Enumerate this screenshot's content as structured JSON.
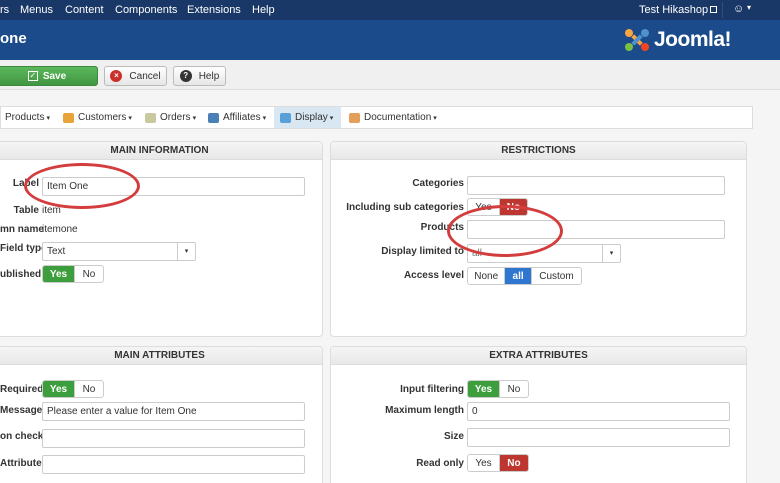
{
  "menubar": {
    "items": [
      "rs",
      "Menus",
      "Content",
      "Components",
      "Extensions",
      "Help"
    ],
    "user": "Test Hikashop",
    "user_icon": "user-icon"
  },
  "header": {
    "title": "one",
    "logo_text": "Joomla!"
  },
  "toolbar": {
    "save_label": "Save",
    "cancel_label": "Cancel",
    "help_label": "Help"
  },
  "nav": {
    "items": [
      {
        "label": "Products",
        "icon": "products-icon"
      },
      {
        "label": "Customers",
        "icon": "customers-icon"
      },
      {
        "label": "Orders",
        "icon": "orders-icon"
      },
      {
        "label": "Affiliates",
        "icon": "affiliates-icon"
      },
      {
        "label": "Display",
        "icon": "display-icon"
      },
      {
        "label": "Documentation",
        "icon": "documentation-icon"
      }
    ],
    "active": "Display"
  },
  "main_information": {
    "title": "MAIN INFORMATION",
    "label_label": "Label",
    "label_value": "Item One",
    "table_label": "Table",
    "table_value": "item",
    "column_label": "mn name",
    "column_value": "itemone",
    "field_type_label": "Field type",
    "field_type_value": "Text",
    "published_label": "ublished",
    "published_yes": "Yes",
    "published_no": "No"
  },
  "restrictions": {
    "title": "RESTRICTIONS",
    "categories_label": "Categories",
    "categories_value": "",
    "subcat_label": "Including sub categories",
    "subcat_yes": "Yes",
    "subcat_no": "No",
    "products_label": "Products",
    "products_value": "",
    "display_limited_label": "Display limited to",
    "display_limited_value": "all",
    "access_label": "Access level",
    "access_none": "None",
    "access_all": "all",
    "access_custom": "Custom"
  },
  "main_attributes": {
    "title": "MAIN ATTRIBUTES",
    "required_label": "Required",
    "required_yes": "Yes",
    "required_no": "No",
    "message_label": "Message",
    "message_value": "Please enter a value for Item One",
    "check_label": "on check",
    "check_value": "",
    "attributes_label": "Attributes",
    "attributes_value": ""
  },
  "extra_attributes": {
    "title": "EXTRA ATTRIBUTES",
    "input_filtering_label": "Input filtering",
    "input_filtering_yes": "Yes",
    "input_filtering_no": "No",
    "max_length_label": "Maximum length",
    "max_length_value": "0",
    "size_label": "Size",
    "size_value": "",
    "readonly_label": "Read only",
    "readonly_yes": "Yes",
    "readonly_no": "No"
  },
  "colors": {
    "menubar": "#1a3867",
    "header": "#1b4b8a",
    "green": "#3c9e3c",
    "red": "#bd362f",
    "blue": "#2f76d0",
    "annotation": "#d43d3d"
  }
}
